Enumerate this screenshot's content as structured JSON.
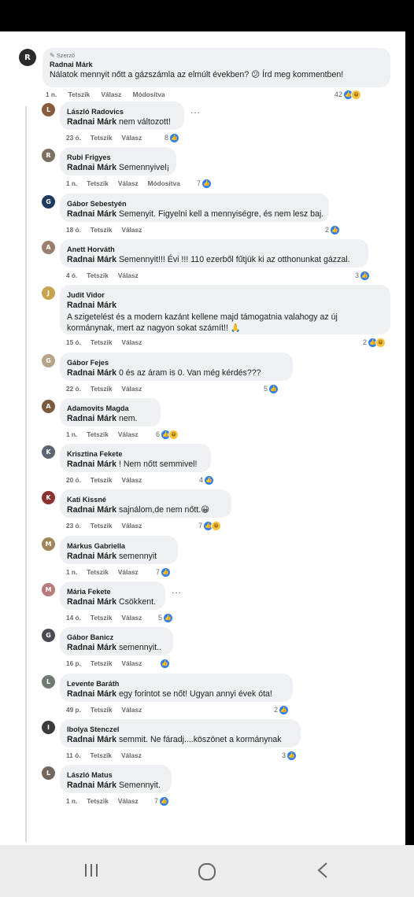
{
  "post": {
    "author_badge": "Szerző",
    "author": "Radnai Márk",
    "text": "Nálatok mennyit nőtt a gázszámla az elmúlt években? 😕 Írd meg kommentben!",
    "time": "1 n.",
    "like_label": "Tetszik",
    "reply_label": "Válasz",
    "edited_label": "Módosítva",
    "reaction_count": "42"
  },
  "comments": [
    {
      "name": "László Radovics",
      "mention": "Radnai Márk",
      "text": " nem változott!",
      "time": "23 ó.",
      "like": "Tetszik",
      "reply": "Válasz",
      "edited": "",
      "count": "8"
    },
    {
      "name": "Rubi Frigyes",
      "mention": "Radnai Márk",
      "text": " Semennyivel¡",
      "time": "1 n.",
      "like": "Tetszik",
      "reply": "Válasz",
      "edited": "Módosítva",
      "count": "7"
    },
    {
      "name": "Gábor Sebestyén",
      "mention": "Radnai Márk",
      "text": " Semenyit. Figyelni kell a mennyiségre, és nem lesz baj.",
      "time": "18 ó.",
      "like": "Tetszik",
      "reply": "Válasz",
      "edited": "",
      "count": "2"
    },
    {
      "name": "Anett Horváth",
      "mention": "Radnai Márk",
      "text": " Semennyit!!! Évi !!! 110 ezerből fűtjük ki az otthonunkat gázzal.",
      "time": "4 ó.",
      "like": "Tetszik",
      "reply": "Válasz",
      "edited": "",
      "count": "3"
    },
    {
      "name": "Judit Vidor",
      "mention": "Radnai Márk",
      "text": "A szigetelést és a modern kazánt kellene majd támogatnia valahogy az új kormánynak, mert az nagyon sokat számít!! 🙏",
      "time": "15 ó.",
      "like": "Tetszik",
      "reply": "Válasz",
      "edited": "",
      "count": "2"
    },
    {
      "name": "Gábor Fejes",
      "mention": "Radnai Márk",
      "text": " 0 és az áram is 0. Van még kérdés???",
      "time": "22 ó.",
      "like": "Tetszik",
      "reply": "Válasz",
      "edited": "",
      "count": "5"
    },
    {
      "name": "Adamovits Magda",
      "mention": "Radnai Márk",
      "text": " nem.",
      "time": "1 n.",
      "like": "Tetszik",
      "reply": "Válasz",
      "edited": "",
      "count": "6"
    },
    {
      "name": "Krisztina Fekete",
      "mention": "Radnai Márk",
      "text": " ! Nem nőtt semmivel!",
      "time": "20 ó.",
      "like": "Tetszik",
      "reply": "Válasz",
      "edited": "",
      "count": "4"
    },
    {
      "name": "Kati Kissné",
      "mention": "Radnai Márk",
      "text": " sajnálom,de nem nőtt.😀",
      "time": "23 ó.",
      "like": "Tetszik",
      "reply": "Válasz",
      "edited": "",
      "count": "7"
    },
    {
      "name": "Márkus Gabriella",
      "mention": "Radnai Márk",
      "text": " semennyit",
      "time": "1 n.",
      "like": "Tetszik",
      "reply": "Válasz",
      "edited": "",
      "count": "7"
    },
    {
      "name": "Mária Fekete",
      "mention": "Radnai Márk",
      "text": " Csökkent.",
      "time": "14 ó.",
      "like": "Tetszik",
      "reply": "Válasz",
      "edited": "",
      "count": "5"
    },
    {
      "name": "Gábor Banicz",
      "mention": "Radnai Márk",
      "text": " semennyit..",
      "time": "16 p.",
      "like": "Tetszik",
      "reply": "Válasz",
      "edited": "",
      "count": ""
    },
    {
      "name": "Levente Baráth",
      "mention": "Radnai Márk",
      "text": " egy forintot se nőt! Ugyan annyi évek óta!",
      "time": "49 p.",
      "like": "Tetszik",
      "reply": "Válasz",
      "edited": "",
      "count": "2"
    },
    {
      "name": "Ibolya Stenczel",
      "mention": "Radnai Márk",
      "text": " semmit. Ne fáradj....köszönet a kormánynak",
      "time": "11 ó.",
      "like": "Tetszik",
      "reply": "Válasz",
      "edited": "",
      "count": "3"
    },
    {
      "name": "László Matus",
      "mention": "Radnai Márk",
      "text": " Semennyit.",
      "time": "1 n.",
      "like": "Tetszik",
      "reply": "Válasz",
      "edited": "",
      "count": "7"
    }
  ],
  "more_menu": "...",
  "icons": {
    "like": "like-icon",
    "haha": "haha-icon",
    "pencil": "pencil-icon",
    "nav_recents": "recents-icon",
    "nav_home": "home-icon",
    "nav_back": "back-icon"
  },
  "colors": {
    "like_blue": "#2d7ff1",
    "bubble": "#eef0f3",
    "meta": "#65676b"
  }
}
